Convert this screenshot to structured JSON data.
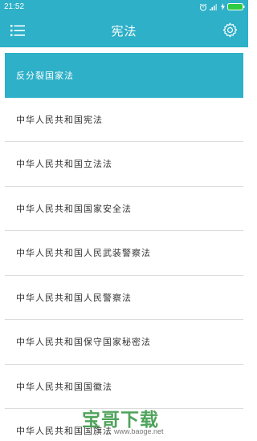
{
  "status_bar": {
    "time": "21:52"
  },
  "header": {
    "title": "宪法"
  },
  "list": {
    "items": [
      {
        "label": "反分裂国家法"
      },
      {
        "label": "中华人民共和国宪法"
      },
      {
        "label": "中华人民共和国立法法"
      },
      {
        "label": "中华人民共和国国家安全法"
      },
      {
        "label": "中华人民共和国人民武装警察法"
      },
      {
        "label": "中华人民共和国人民警察法"
      },
      {
        "label": "中华人民共和国保守国家秘密法"
      },
      {
        "label": "中华人民共和国国徽法"
      },
      {
        "label": "中华人民共和国国旗法"
      }
    ]
  },
  "watermark": {
    "brand": "宝哥下载",
    "url": "www.baoge.net"
  },
  "colors": {
    "accent": "#2db0c8",
    "divider": "#dcdcdc",
    "text": "#333333"
  },
  "icons": {
    "menu": "list-menu-icon",
    "settings": "gear-icon"
  }
}
